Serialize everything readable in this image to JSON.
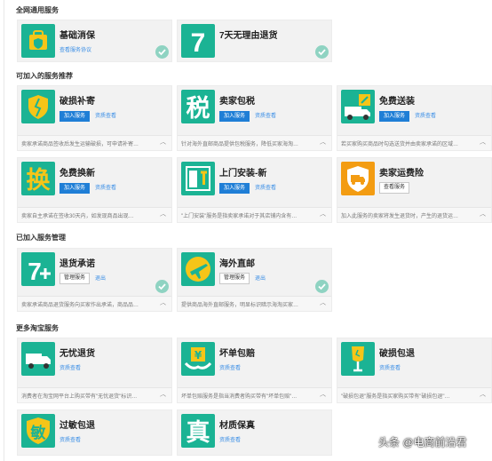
{
  "sections": {
    "s1": "全网通用服务",
    "s2": "可加入的服务推荐",
    "s3": "已加入服务管理",
    "s4": "更多淘宝服务"
  },
  "cards": {
    "jichu": {
      "name": "基础消保",
      "link": "查看服务协议"
    },
    "qitian": {
      "name": "7天无理由退货"
    },
    "posun": {
      "name": "破损补寄",
      "btn": "加入服务",
      "link": "资质查看",
      "desc": "卖家承诺商品签收后发生运输破损，可申请补寄…"
    },
    "baoshui": {
      "name": "卖家包税",
      "btn": "加入服务",
      "link": "资质查看",
      "desc": "针对海外直邮商品提供包税服务，降低买家海淘…"
    },
    "songzhuang": {
      "name": "免费送装",
      "btn": "加入服务",
      "link": "资质查看",
      "desc": "若买家购买商品时勾选送货并由卖家承诺的区域…"
    },
    "huanxin": {
      "name": "免费换新",
      "btn": "加入服务",
      "link": "资质查看",
      "desc": "卖家自主承诺在签收30天内，如发现商品出现…"
    },
    "shangmen": {
      "name": "上门安装-新",
      "btn": "加入服务",
      "link": "资质查看",
      "desc": "\"上门安装\"服务是指卖家承诺对于其店铺内含有…"
    },
    "yunfei": {
      "name": "卖家运费险",
      "btn": "查看服务",
      "desc": "加入此服务的卖家将发生退货时，产生的退货运…"
    },
    "tuihuo": {
      "name": "退货承诺",
      "btn": "管理服务",
      "link": "退出",
      "desc": "卖家承诺商品退货服务向买家作出承诺，商品品…"
    },
    "haiwai": {
      "name": "海外直邮",
      "btn": "管理服务",
      "link": "退出",
      "desc": "提供商品海外直邮服务，明显标识暗示海淘买家…"
    },
    "wuyou": {
      "name": "无忧退货",
      "link": "资质查看",
      "desc": "消费者在淘宝网平台上购买带有\"无忧退货\"标识…"
    },
    "huaidan": {
      "name": "坏单包赔",
      "link": "资质查看",
      "desc": "坏单包赔服务是指当消费者购买带有\"坏单包赔\"…"
    },
    "posunbao": {
      "name": "破损包退",
      "link": "资质查看",
      "desc": "\"破损包退\"服务是指买家购买带有\"破损包退\"…"
    },
    "guomin": {
      "name": "过敏包退",
      "link": "资质查看"
    },
    "caizhi": {
      "name": "材质保真",
      "link": "资质查看"
    }
  },
  "icons": {
    "jichu": "shield-bag-icon",
    "qitian": "seven-days-icon",
    "posun": "broken-shield-icon",
    "baoshui": "tax-char-icon",
    "songzhuang": "delivery-truck-wrench-icon",
    "huanxin": "exchange-char-icon",
    "shangmen": "install-door-icon",
    "yunfei": "truck-shield-icon",
    "tuihuo": "seven-plus-icon",
    "haiwai": "airplane-icon",
    "wuyou": "return-truck-icon",
    "huaidan": "yen-hands-icon",
    "posunbao": "broken-glass-icon",
    "guomin": "allergy-char-icon",
    "caizhi": "genuine-char-icon"
  },
  "glyphs": {
    "baoshui": "税",
    "huanxin": "换",
    "guomin": "敏",
    "caizhi": "真"
  },
  "colors": {
    "accent_teal": "#1bb394",
    "accent_yellow": "#f5c518",
    "accent_orange": "#f39c12",
    "button_blue": "#1f7ed6",
    "link_blue": "#3a8ee6"
  },
  "watermark": "头条 @电商前沿君"
}
